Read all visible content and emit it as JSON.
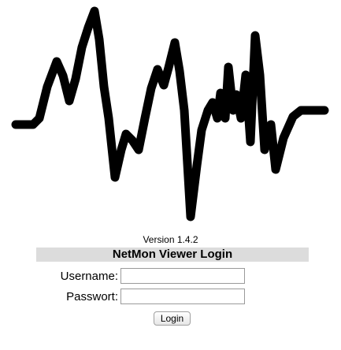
{
  "header": {
    "version": "Version 1.4.2",
    "title": "NetMon Viewer Login"
  },
  "form": {
    "username_label": "Username:",
    "username_value": "",
    "password_label": "Passwort:",
    "password_value": "",
    "login_label": "Login"
  },
  "logo": {
    "icon": "waveform-logo-icon",
    "color": "#000000"
  }
}
